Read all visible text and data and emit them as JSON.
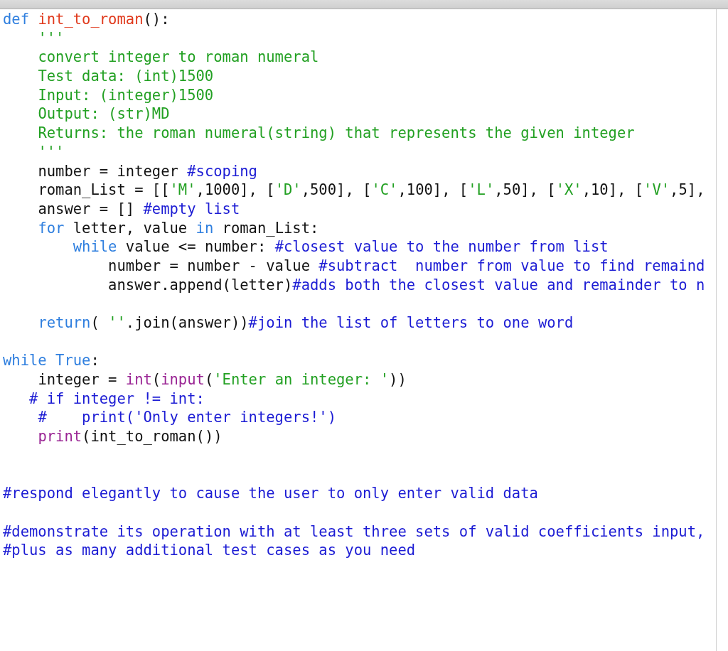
{
  "lines": [
    {
      "tokens": [
        {
          "kind": "keyword",
          "text": "def "
        },
        {
          "kind": "defname",
          "text": "int_to_roman"
        },
        {
          "kind": "plain",
          "text": "():"
        }
      ]
    },
    {
      "tokens": [
        {
          "kind": "string",
          "text": "    '''"
        }
      ]
    },
    {
      "tokens": [
        {
          "kind": "string",
          "text": "    convert integer to roman numeral"
        }
      ]
    },
    {
      "tokens": [
        {
          "kind": "string",
          "text": "    Test data: (int)1500"
        }
      ]
    },
    {
      "tokens": [
        {
          "kind": "string",
          "text": "    Input: (integer)1500"
        }
      ]
    },
    {
      "tokens": [
        {
          "kind": "string",
          "text": "    Output: (str)MD"
        }
      ]
    },
    {
      "tokens": [
        {
          "kind": "string",
          "text": "    Returns: the roman numeral(string) that represents the given integer"
        }
      ]
    },
    {
      "tokens": [
        {
          "kind": "string",
          "text": "    '''"
        }
      ]
    },
    {
      "tokens": [
        {
          "kind": "plain",
          "text": "    number = integer "
        },
        {
          "kind": "comment",
          "text": "#scoping"
        }
      ]
    },
    {
      "tokens": [
        {
          "kind": "plain",
          "text": "    roman_List = [["
        },
        {
          "kind": "string",
          "text": "'M'"
        },
        {
          "kind": "plain",
          "text": ",1000], ["
        },
        {
          "kind": "string",
          "text": "'D'"
        },
        {
          "kind": "plain",
          "text": ",500], ["
        },
        {
          "kind": "string",
          "text": "'C'"
        },
        {
          "kind": "plain",
          "text": ",100], ["
        },
        {
          "kind": "string",
          "text": "'L'"
        },
        {
          "kind": "plain",
          "text": ",50], ["
        },
        {
          "kind": "string",
          "text": "'X'"
        },
        {
          "kind": "plain",
          "text": ",10], ["
        },
        {
          "kind": "string",
          "text": "'V'"
        },
        {
          "kind": "plain",
          "text": ",5],"
        }
      ]
    },
    {
      "tokens": [
        {
          "kind": "plain",
          "text": "    answer = [] "
        },
        {
          "kind": "comment",
          "text": "#empty list"
        }
      ]
    },
    {
      "tokens": [
        {
          "kind": "keyword",
          "text": "    for"
        },
        {
          "kind": "plain",
          "text": " letter, value "
        },
        {
          "kind": "keyword",
          "text": "in"
        },
        {
          "kind": "plain",
          "text": " roman_List:"
        }
      ]
    },
    {
      "tokens": [
        {
          "kind": "keyword",
          "text": "        while"
        },
        {
          "kind": "plain",
          "text": " value <= number: "
        },
        {
          "kind": "comment",
          "text": "#closest value to the number from list"
        }
      ]
    },
    {
      "tokens": [
        {
          "kind": "plain",
          "text": "            number = number - value "
        },
        {
          "kind": "comment",
          "text": "#subtract  number from value to find remaind"
        }
      ]
    },
    {
      "tokens": [
        {
          "kind": "plain",
          "text": "            answer.append(letter)"
        },
        {
          "kind": "comment",
          "text": "#adds both the closest value and remainder to n"
        }
      ]
    },
    {
      "kind": "blank"
    },
    {
      "tokens": [
        {
          "kind": "keyword",
          "text": "    return"
        },
        {
          "kind": "plain",
          "text": "( "
        },
        {
          "kind": "string",
          "text": "''"
        },
        {
          "kind": "plain",
          "text": ".join(answer))"
        },
        {
          "kind": "comment",
          "text": "#join the list of letters to one word"
        }
      ]
    },
    {
      "kind": "blank"
    },
    {
      "tokens": [
        {
          "kind": "keyword",
          "text": "while True"
        },
        {
          "kind": "plain",
          "text": ":"
        }
      ]
    },
    {
      "tokens": [
        {
          "kind": "plain",
          "text": "    integer = "
        },
        {
          "kind": "builtin",
          "text": "int"
        },
        {
          "kind": "plain",
          "text": "("
        },
        {
          "kind": "builtin",
          "text": "input"
        },
        {
          "kind": "plain",
          "text": "("
        },
        {
          "kind": "string",
          "text": "'Enter an integer: '"
        },
        {
          "kind": "plain",
          "text": "))"
        }
      ]
    },
    {
      "tokens": [
        {
          "kind": "comment",
          "text": "   # if integer != int:"
        }
      ]
    },
    {
      "tokens": [
        {
          "kind": "comment",
          "text": "    #    print('Only enter integers!')"
        }
      ]
    },
    {
      "tokens": [
        {
          "kind": "builtin",
          "text": "    print"
        },
        {
          "kind": "plain",
          "text": "(int_to_roman())"
        }
      ]
    },
    {
      "kind": "blank"
    },
    {
      "kind": "blank"
    },
    {
      "tokens": [
        {
          "kind": "comment",
          "text": "#respond elegantly to cause the user to only enter valid data"
        }
      ]
    },
    {
      "kind": "blank"
    },
    {
      "tokens": [
        {
          "kind": "comment",
          "text": "#demonstrate its operation with at least three sets of valid coefficients input,"
        }
      ]
    },
    {
      "tokens": [
        {
          "kind": "comment",
          "text": "#plus as many additional test cases as you need"
        }
      ]
    }
  ]
}
